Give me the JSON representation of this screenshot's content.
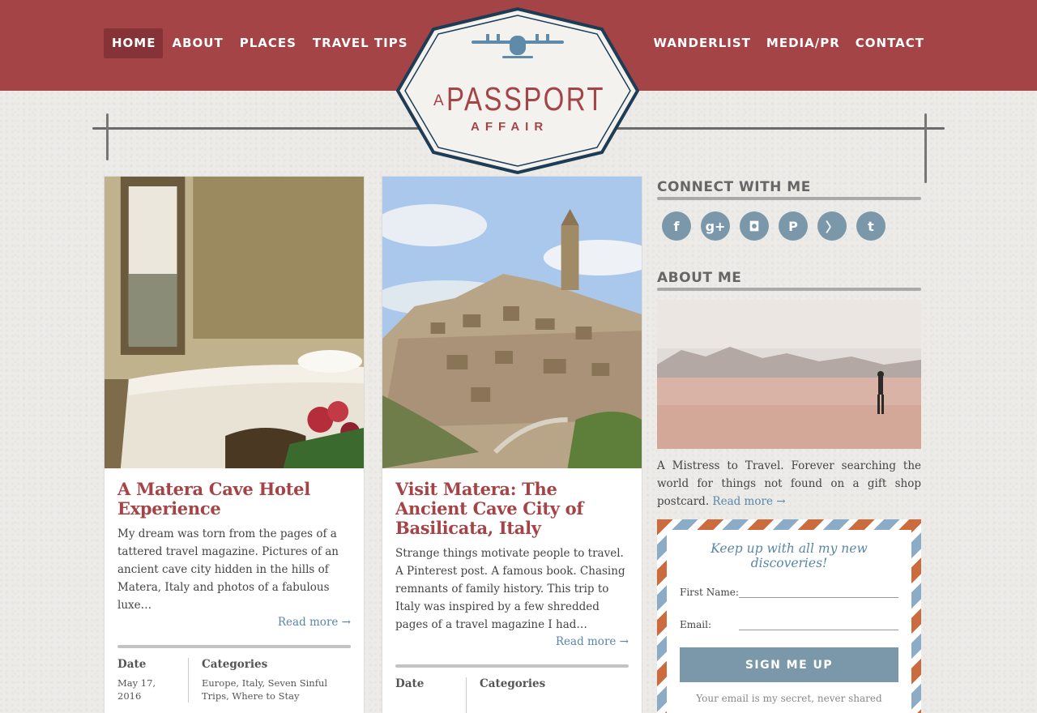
{
  "nav": {
    "left": [
      {
        "label": "HOME",
        "active": true
      },
      {
        "label": "ABOUT"
      },
      {
        "label": "PLACES"
      },
      {
        "label": "TRAVEL TIPS"
      }
    ],
    "right": [
      {
        "label": "WANDERLIST"
      },
      {
        "label": "MEDIA/PR"
      },
      {
        "label": "CONTACT"
      }
    ]
  },
  "logo": {
    "prefix": "A",
    "name": "PASSPORT",
    "suffix": "AFFAIR"
  },
  "posts": [
    {
      "title": "A Matera Cave Hotel Experience",
      "excerpt": "My dream was torn from the pages of a tattered travel magazine. Pictures of an  ancient cave city hidden in the hills of Matera, Italy and photos of a fabulous luxe…",
      "read_more": "Read more →",
      "date_label": "Date",
      "date": "May 17, 2016",
      "categories_label": "Categories",
      "categories": "Europe, Italy, Seven Sinful Trips, Where to Stay"
    },
    {
      "title": "Visit Matera: The Ancient Cave City of Basilicata, Italy",
      "excerpt": "Strange  things motivate people to travel.  A Pinterest post. A  famous book.  Chasing  remnants of family history. This trip to Italy was inspired  by a few shredded pages of a travel magazine I had…",
      "read_more": "Read more →",
      "date_label": "Date",
      "categories_label": "Categories"
    }
  ],
  "sidebar": {
    "connect_title": "CONNECT WITH ME",
    "social": [
      {
        "icon": "facebook-icon",
        "glyph": "f"
      },
      {
        "icon": "google-plus-icon",
        "glyph": "g+"
      },
      {
        "icon": "instagram-icon",
        "glyph": "◘"
      },
      {
        "icon": "pinterest-icon",
        "glyph": "P"
      },
      {
        "icon": "rss-icon",
        "glyph": "〉"
      },
      {
        "icon": "twitter-icon",
        "glyph": "t"
      }
    ],
    "about_title": "ABOUT ME",
    "about_text": "A Mistress to Travel. Forever searching the world for things not found on a gift shop postcard.",
    "about_read_more": "Read more →"
  },
  "newsletter": {
    "tagline": "Keep up with all my new discoveries!",
    "first_name_label": "First Name:",
    "email_label": "Email:",
    "button": "SIGN ME UP",
    "note": "Your email is my secret, never shared"
  },
  "colors": {
    "brand_red": "#a54447",
    "nav_active": "#853336",
    "accent_blue": "#7b98ab",
    "link_blue": "#5a86a6"
  }
}
